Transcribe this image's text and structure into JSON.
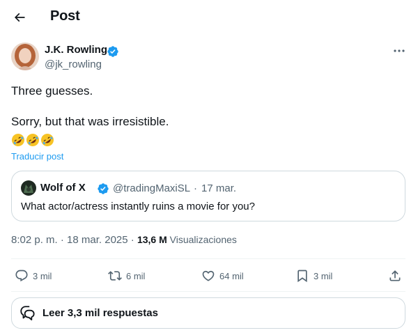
{
  "header": {
    "title": "Post",
    "back_icon": "arrow-left-icon"
  },
  "author": {
    "name": "J.K. Rowling",
    "handle": "@jk_rowling",
    "verified": true,
    "verified_color": "#1d9bf0"
  },
  "tweet": {
    "lines": [
      "Three guesses.",
      "Sorry, but that was irresistible."
    ],
    "emojis": [
      "rolling-on-floor-laughing-icon",
      "rolling-on-floor-laughing-icon",
      "rolling-on-floor-laughing-icon"
    ],
    "translate_label": "Traducir post"
  },
  "quoted": {
    "name": "Wolf of X",
    "handle": "@tradingMaxiSL",
    "separator": "·",
    "date": "17 mar.",
    "text": "What actor/actress instantly ruins a movie for you?"
  },
  "meta": {
    "time": "8:02 p. m.",
    "separator": "·",
    "date": "18 mar. 2025",
    "separator2": "·",
    "views_count": "13,6 M",
    "views_label": "Visualizaciones"
  },
  "actions": {
    "replies": "3 mil",
    "reposts": "6 mil",
    "likes": "64 mil",
    "bookmarks": "3 mil"
  },
  "read_replies": {
    "label": "Leer 3,3 mil respuestas"
  },
  "colors": {
    "text": "#0f1419",
    "secondary": "#536471",
    "accent": "#1d9bf0",
    "border": "#cfd9de"
  }
}
